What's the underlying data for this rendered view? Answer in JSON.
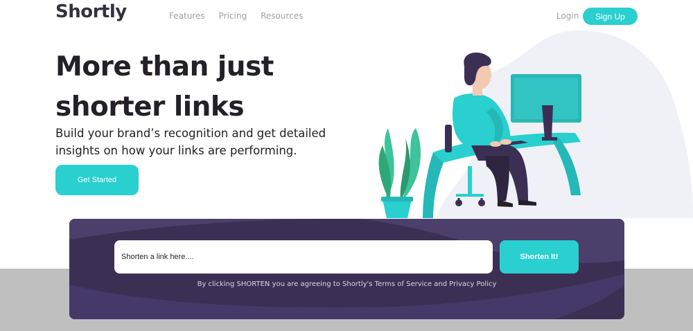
{
  "nav": {
    "logo": "Shortly",
    "links": [
      {
        "label": "Features"
      },
      {
        "label": "Pricing"
      },
      {
        "label": "Resources"
      }
    ],
    "login": "Login",
    "signup": "Sign Up"
  },
  "hero": {
    "title": "More than just shorter links",
    "subtitle": "Build your brand’s recognition and get detailed insights on how your links are performing.",
    "cta": "Get Started"
  },
  "shorten": {
    "placeholder": "Shorten a link here....",
    "button": "Shorten It!",
    "terms": "By clicking SHORTEN you are agreeing to Shortly's Terms of Service and Privacy Policy"
  },
  "colors": {
    "accent": "#2acfcf",
    "dark_violet": "#3b3054",
    "text": "#232127",
    "gray": "#a0a0a8"
  },
  "icons": {
    "illustration": "person-working-at-desk-illustration"
  }
}
